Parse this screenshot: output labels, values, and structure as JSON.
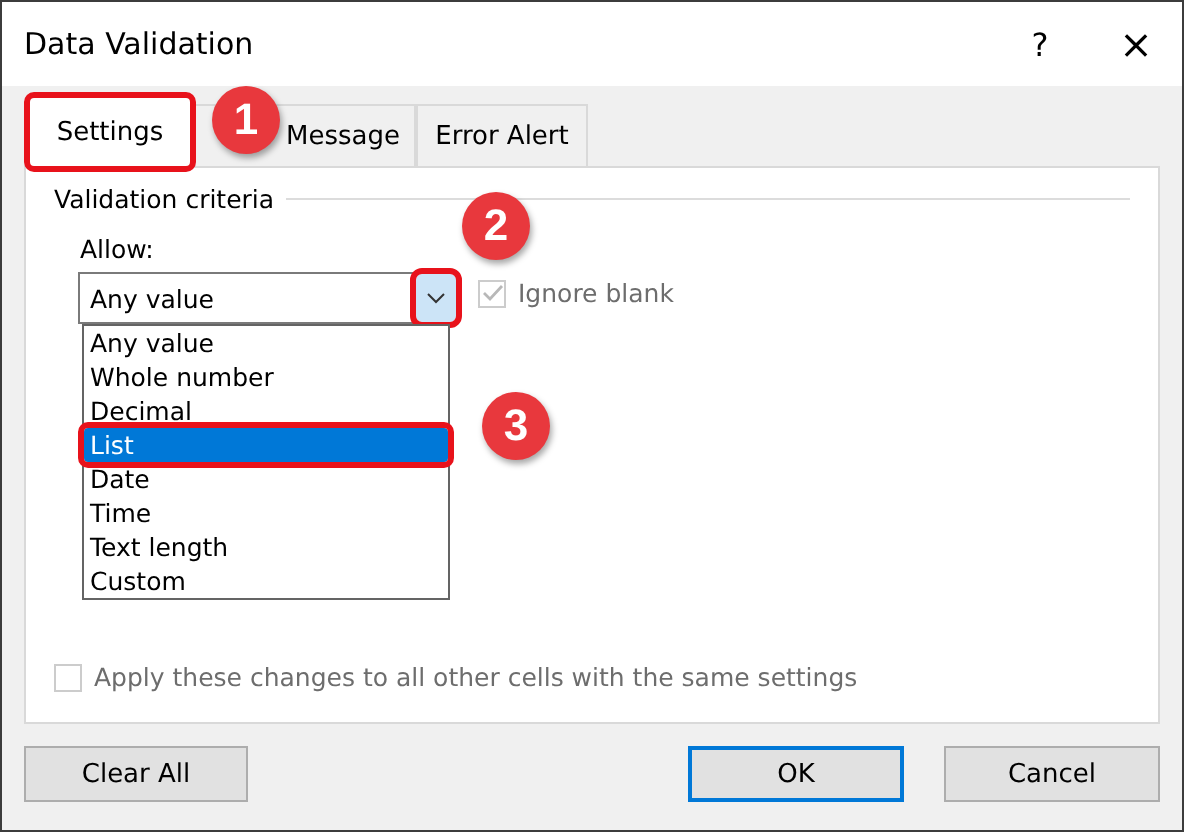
{
  "window": {
    "title": "Data Validation",
    "help": "?",
    "close": "×"
  },
  "tabs": [
    {
      "label": "Settings",
      "selected": true,
      "highlighted": true
    },
    {
      "label": "Message",
      "selected": false,
      "highlighted": false
    },
    {
      "label": "Error Alert",
      "selected": false,
      "highlighted": false
    }
  ],
  "criteria": {
    "heading": "Validation criteria",
    "allow_label": "Allow:",
    "allow_value": "Any value",
    "dropdown_highlighted": true,
    "ignore_blank": {
      "label": "Ignore blank",
      "checked": true,
      "disabled": true
    },
    "options": [
      {
        "label": "Any value",
        "selected": false,
        "highlighted": false
      },
      {
        "label": "Whole number",
        "selected": false,
        "highlighted": false
      },
      {
        "label": "Decimal",
        "selected": false,
        "highlighted": false
      },
      {
        "label": "List",
        "selected": true,
        "highlighted": true
      },
      {
        "label": "Date",
        "selected": false,
        "highlighted": false
      },
      {
        "label": "Time",
        "selected": false,
        "highlighted": false
      },
      {
        "label": "Text length",
        "selected": false,
        "highlighted": false
      },
      {
        "label": "Custom",
        "selected": false,
        "highlighted": false
      }
    ]
  },
  "apply_all": {
    "label": "Apply these changes to all other cells with the same settings",
    "checked": false,
    "disabled": true
  },
  "buttons": [
    {
      "label": "Clear All",
      "kind": "normal"
    },
    {
      "label": "OK",
      "kind": "default"
    },
    {
      "label": "Cancel",
      "kind": "normal"
    }
  ],
  "callouts": [
    "1",
    "2",
    "3"
  ]
}
